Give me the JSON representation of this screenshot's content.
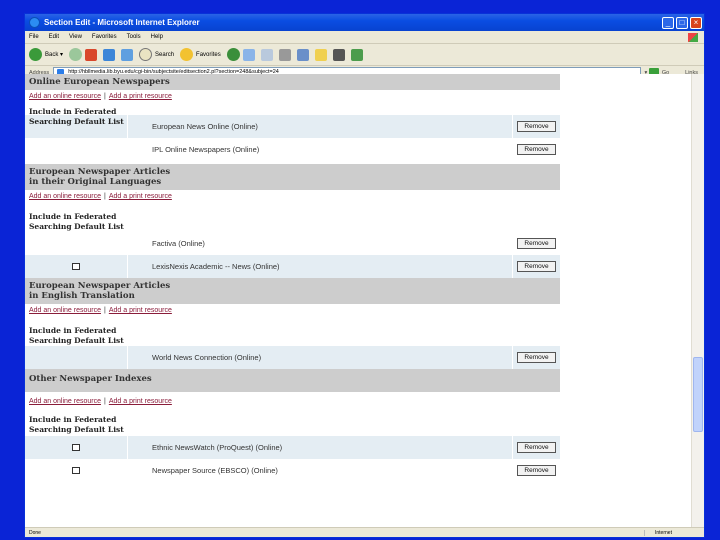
{
  "window": {
    "title": "Section Edit - Microsoft Internet Explorer"
  },
  "menu": [
    "File",
    "Edit",
    "View",
    "Favorites",
    "Tools",
    "Help"
  ],
  "toolbar": {
    "back": "Back",
    "search": "Search",
    "favorites": "Favorites"
  },
  "addressbar": {
    "label": "Address",
    "url": "http://hbllmedia.lib.byu.edu/cgi-bin/subjectsite/editsection2.pl?section=248&subject=24",
    "go": "Go",
    "links": "Links"
  },
  "remove_label": "Remove",
  "add_online": "Add an online resource",
  "add_print": "Add a print resource",
  "separator": "|",
  "fed_label_1": "Include in Federated",
  "fed_label_2": "Searching Default List",
  "sections": [
    {
      "title_1": "Online European Newspapers",
      "title_2": "",
      "rows": [
        {
          "name": "European News Online (Online)",
          "checkbox": false
        },
        {
          "name": "IPL Online Newspapers (Online)",
          "checkbox": false
        }
      ]
    },
    {
      "title_1": "European Newspaper Articles",
      "title_2": "in their Original Languages",
      "rows": [
        {
          "name": "Factiva (Online)",
          "checkbox": false
        },
        {
          "name": "LexisNexis Academic -- News (Online)",
          "checkbox": true
        }
      ]
    },
    {
      "title_1": "European Newspaper Articles",
      "title_2": "in English Translation",
      "rows": [
        {
          "name": "World News Connection (Online)",
          "checkbox": false
        }
      ]
    },
    {
      "title_1": "Other Newspaper Indexes",
      "title_2": "",
      "rows": [
        {
          "name": "Ethnic NewsWatch (ProQuest) (Online)",
          "checkbox": true
        },
        {
          "name": "Newspaper Source (EBSCO) (Online)",
          "checkbox": true
        }
      ]
    }
  ],
  "status": {
    "left": "Done",
    "zone": "Internet"
  }
}
